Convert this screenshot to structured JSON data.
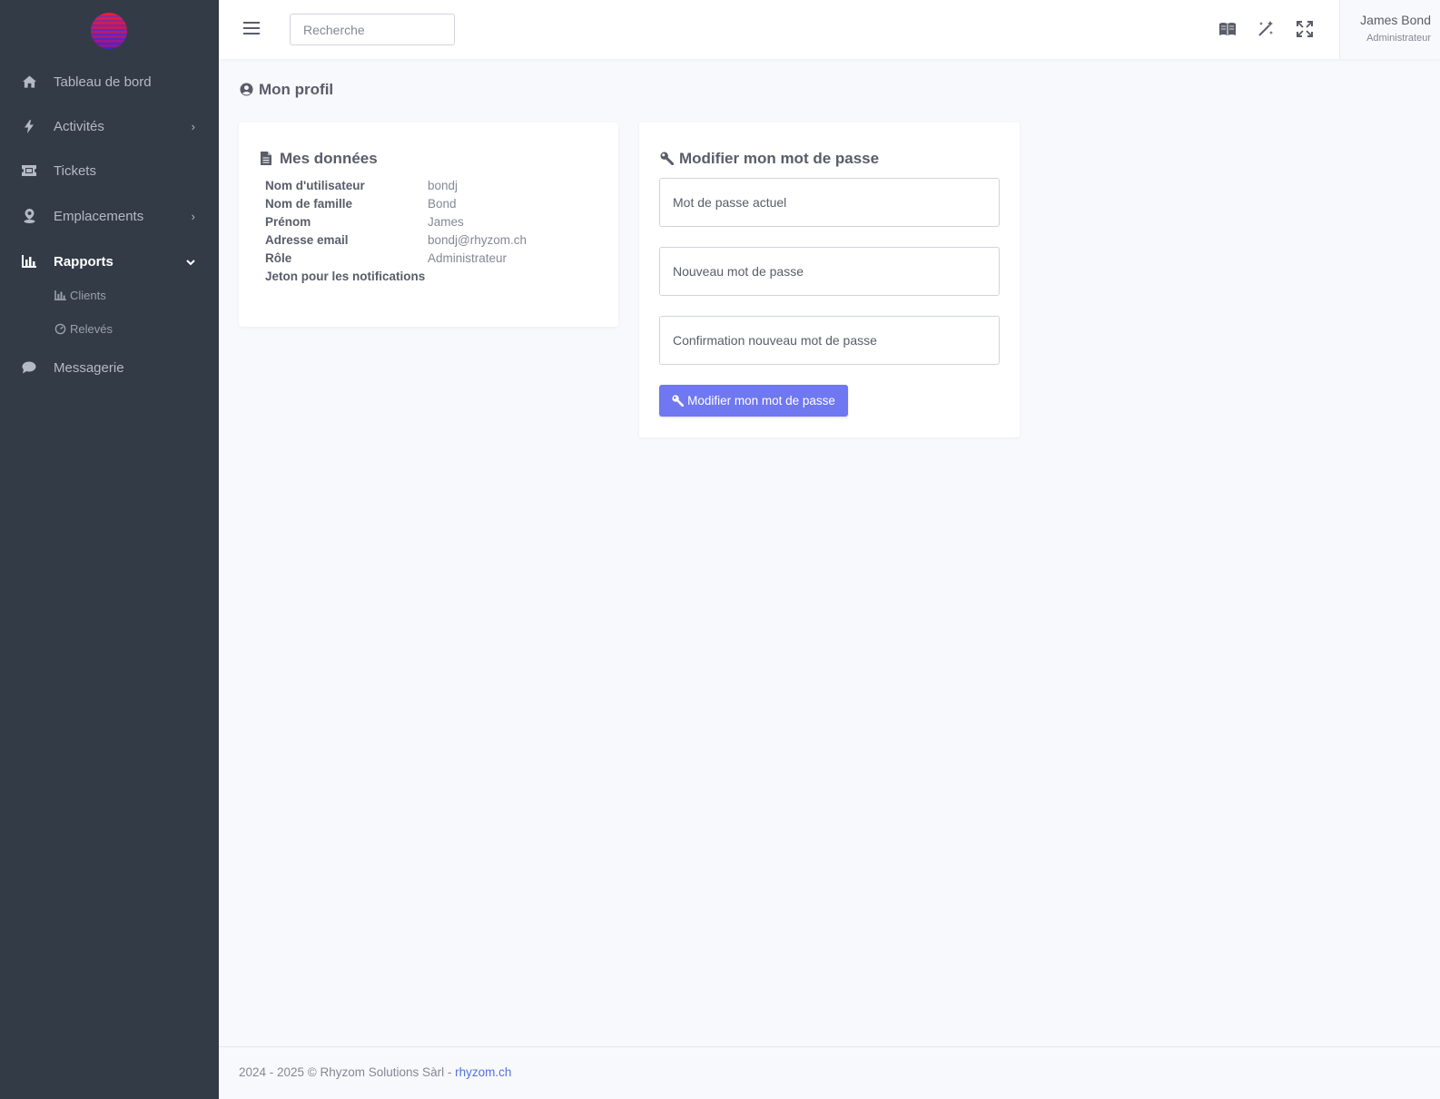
{
  "sidebar": {
    "logo": "Rhyzom logo",
    "items": [
      {
        "label": "Tableau de bord",
        "icon": "home-icon"
      },
      {
        "label": "Activités",
        "icon": "bolt-icon"
      },
      {
        "label": "Tickets",
        "icon": "ticket-icon"
      },
      {
        "label": "Emplacements",
        "icon": "location-pin-icon"
      },
      {
        "label": "Rapports",
        "icon": "bar-chart-icon",
        "active": true
      },
      {
        "label": "Messagerie",
        "icon": "chat-bubble-icon"
      }
    ],
    "subitems": [
      {
        "label": "Clients",
        "icon": "bar-chart-icon"
      },
      {
        "label": "Relevés",
        "icon": "gauge-icon"
      }
    ]
  },
  "topbar": {
    "search_placeholder": "Recherche",
    "icons": [
      "book-icon",
      "magic-wand-icon",
      "fullscreen-icon"
    ],
    "user_name": "James Bond",
    "user_role": "Administrateur"
  },
  "page": {
    "title": "Mon profil",
    "title_icon": "user-circle-icon"
  },
  "data_card": {
    "title": "Mes données",
    "rows": [
      {
        "key": "Nom d'utilisateur",
        "value": "bondj"
      },
      {
        "key": "Nom de famille",
        "value": "Bond"
      },
      {
        "key": "Prénom",
        "value": "James"
      },
      {
        "key": "Adresse email",
        "value": "bondj@rhyzom.ch"
      },
      {
        "key": "Rôle",
        "value": "Administrateur"
      },
      {
        "key": "Jeton pour les notifications",
        "value": ""
      }
    ]
  },
  "password_card": {
    "title": "Modifier mon mot de passe",
    "current_placeholder": "Mot de passe actuel",
    "new_placeholder": "Nouveau mot de passe",
    "confirm_placeholder": "Confirmation nouveau mot de passe",
    "submit_label": "Modifier mon mot de passe"
  },
  "footer": {
    "text": "2024 - 2025 © Rhyzom Solutions Sàrl - ",
    "link": "rhyzom.ch"
  },
  "colors": {
    "sidebar_bg": "#333b47",
    "primary": "#6f78f0",
    "page_bg": "#f8f9fc"
  }
}
